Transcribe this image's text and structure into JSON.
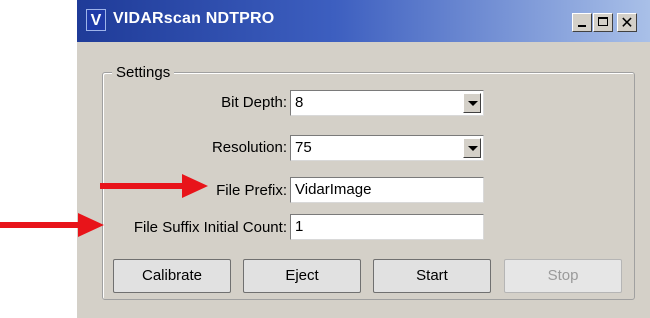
{
  "window": {
    "icon_letter": "V",
    "title": "VIDARscan NDTPRO",
    "close_glyph": "✕"
  },
  "settings": {
    "group_label": "Settings",
    "bit_depth": {
      "label": "Bit Depth:",
      "value": "8"
    },
    "resolution": {
      "label": "Resolution:",
      "value": "75"
    },
    "file_prefix": {
      "label": "File Prefix:",
      "value": "VidarImage"
    },
    "file_suffix": {
      "label": "File Suffix Initial Count:",
      "value": "1"
    }
  },
  "buttons": {
    "calibrate": "Calibrate",
    "eject": "Eject",
    "start": "Start",
    "stop": "Stop"
  },
  "annotations": {
    "arrow_color": "#e8141a"
  }
}
